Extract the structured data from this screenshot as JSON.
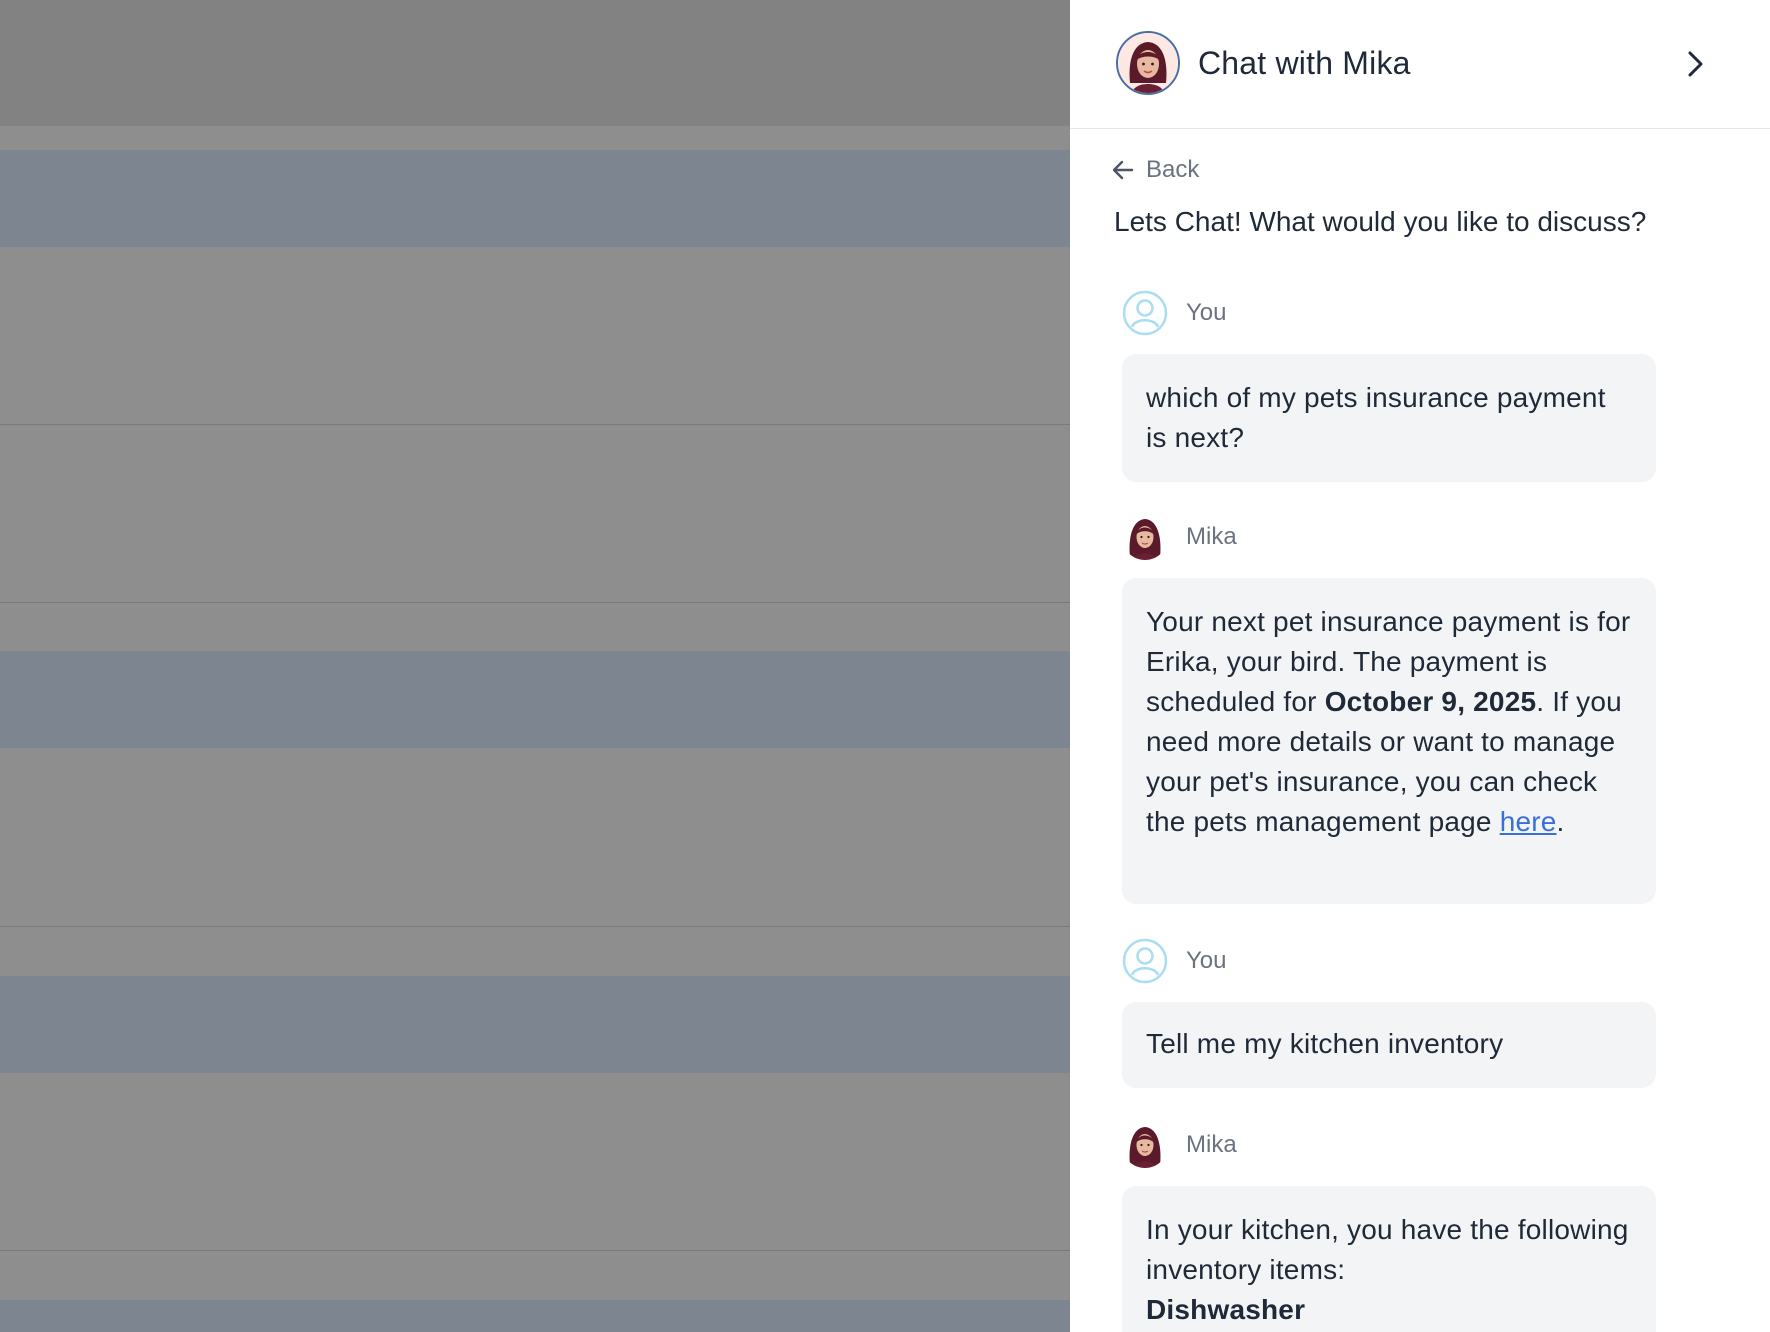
{
  "header": {
    "title": "Chat with Mika",
    "avatar_icon": "mika-avatar-icon",
    "collapse_icon": "chevron-right-icon"
  },
  "nav": {
    "back_label": "Back"
  },
  "prompt": "Lets Chat! What would you like to discuss?",
  "messages": [
    {
      "sender": "You",
      "text": "which of my pets insurance payment is next?"
    },
    {
      "sender": "Mika",
      "text_before": "Your next pet insurance payment is for Erika, your bird. The payment is scheduled for ",
      "date": "October 9, 2025",
      "text_middle": ". If you need more details or want to manage your pet's insurance, you can check the pets management page ",
      "link_label": "here",
      "text_after": "."
    },
    {
      "sender": "You",
      "text": "Tell me my kitchen inventory"
    },
    {
      "sender": "Mika",
      "text": "In your kitchen, you have the following inventory items:",
      "item": "Dishwasher"
    }
  ],
  "colors": {
    "accent_link": "#3b6fd8",
    "bubble_bg": "#f3f4f6",
    "overlay": "#8e8e8e",
    "overlay_band": "#7d8591"
  }
}
